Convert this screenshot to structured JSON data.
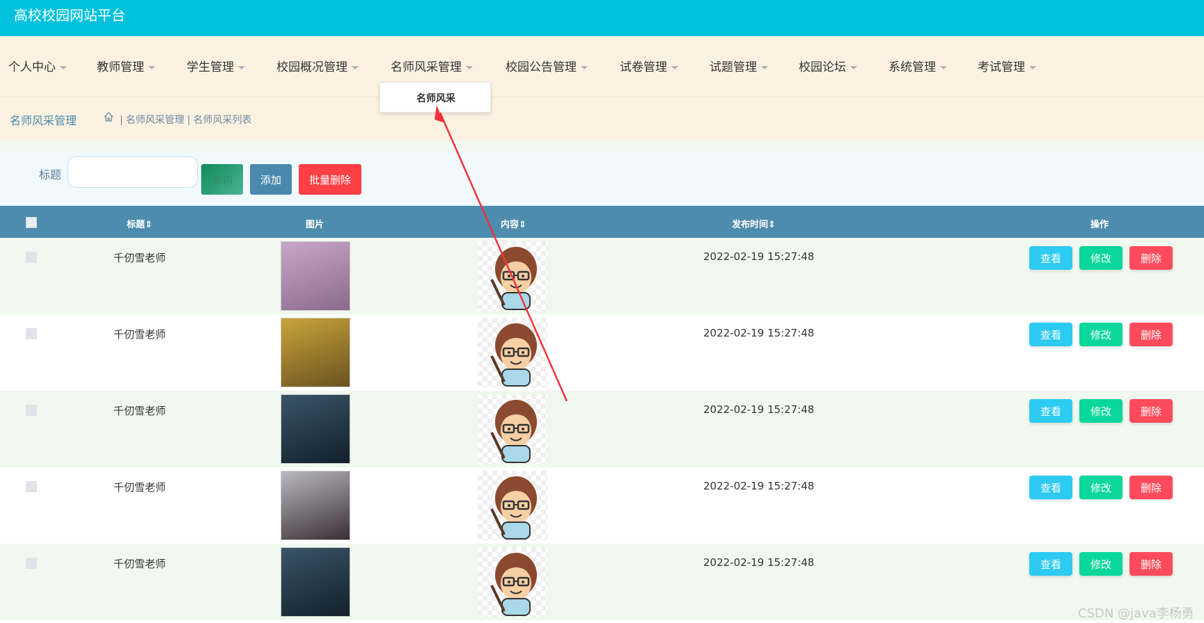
{
  "app": {
    "title": "高校校园网站平台"
  },
  "nav": {
    "items": [
      {
        "label": "个人中心"
      },
      {
        "label": "教师管理"
      },
      {
        "label": "学生管理"
      },
      {
        "label": "校园概况管理"
      },
      {
        "label": "名师风采管理"
      },
      {
        "label": "校园公告管理"
      },
      {
        "label": "试卷管理"
      },
      {
        "label": "试题管理"
      },
      {
        "label": "校园论坛"
      },
      {
        "label": "系统管理"
      },
      {
        "label": "考试管理"
      }
    ],
    "dropdown_item": "名师风采"
  },
  "breadcrumb": {
    "title": "名师风采管理",
    "separator": "|",
    "path1": "名师风采管理",
    "path2": "名师风采列表"
  },
  "search": {
    "label": "标题",
    "placeholder": "",
    "search_btn": "查询",
    "add_btn": "添加",
    "batch_delete_btn": "批量删除"
  },
  "table": {
    "headers": {
      "title": "标题",
      "image": "图片",
      "content": "内容",
      "time": "发布时间",
      "actions": "操作"
    },
    "rows": [
      {
        "title": "千仞雪老师",
        "time": "2022-02-19 15:27:48",
        "image_colors": [
          "#c9a6c7",
          "#8a6a8c"
        ]
      },
      {
        "title": "千仞雪老师",
        "time": "2022-02-19 15:27:48",
        "image_colors": [
          "#c9a43a",
          "#6b5220"
        ]
      },
      {
        "title": "千仞雪老师",
        "time": "2022-02-19 15:27:48",
        "image_colors": [
          "#3a5568",
          "#12202b"
        ]
      },
      {
        "title": "千仞雪老师",
        "time": "2022-02-19 15:27:48",
        "image_colors": [
          "#b9b8c0",
          "#3b2e34"
        ]
      },
      {
        "title": "千仞雪老师",
        "time": "2022-02-19 15:27:48",
        "image_colors": [
          "#3a5568",
          "#12202b"
        ]
      }
    ],
    "actions": {
      "view": "查看",
      "edit": "修改",
      "delete": "删除"
    }
  },
  "watermark": "CSDN @java李杨勇",
  "colors": {
    "topbar": "#00c1dc",
    "nav_bg": "#fdf2e2",
    "table_head": "#4e8cad",
    "btn_view": "#2dcaf2",
    "btn_edit": "#09d79b",
    "btn_delete": "#fe4b5b",
    "annotation_arrow": "#f0333c"
  }
}
